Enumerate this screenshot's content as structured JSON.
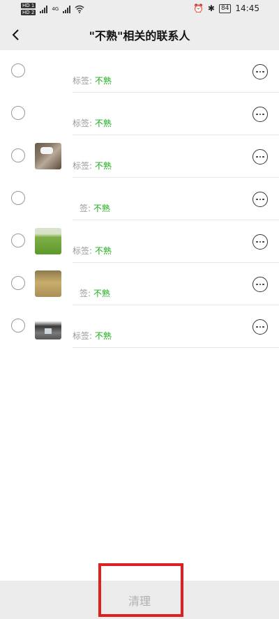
{
  "status_bar": {
    "network_badges": [
      "HD 1",
      "HD 2"
    ],
    "network_type": "4G",
    "battery": "84",
    "time": "14:45"
  },
  "header": {
    "title": "\"不熟\"相关的联系人"
  },
  "contacts": [
    {
      "avatar": "blank",
      "tag_label": "标签:",
      "tag_value": "不熟"
    },
    {
      "avatar": "blank",
      "tag_label": "标签:",
      "tag_value": "不熟"
    },
    {
      "avatar": "cat",
      "tag_label": "标签:",
      "tag_value": "不熟"
    },
    {
      "avatar": "blank",
      "tag_label": "签:",
      "tag_value": "不熟"
    },
    {
      "avatar": "field",
      "tag_label": "标签:",
      "tag_value": "不熟"
    },
    {
      "avatar": "sand",
      "tag_label": "签:",
      "tag_value": "不熟"
    },
    {
      "avatar": "dark",
      "tag_label": "标签:",
      "tag_value": "不熟"
    }
  ],
  "footer": {
    "clear_label": "清理"
  },
  "colors": {
    "tag_value": "#1aad19",
    "highlight_box": "#e02020",
    "header_bg": "#ededed"
  }
}
